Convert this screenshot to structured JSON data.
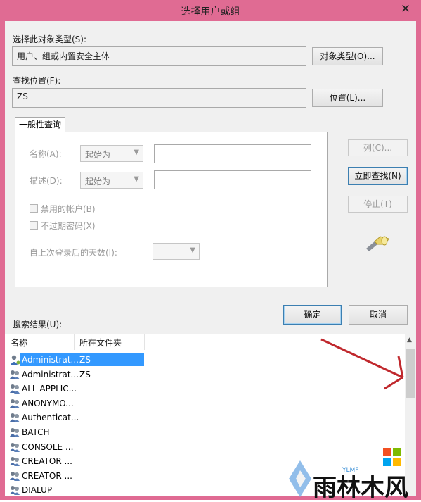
{
  "window": {
    "title": "选择用户或组",
    "close_glyph": "✕"
  },
  "object_type": {
    "label": "选择此对象类型(S):",
    "value": "用户、组或内置安全主体",
    "button": "对象类型(O)..."
  },
  "location": {
    "label": "查找位置(F):",
    "value": "ZS",
    "button": "位置(L)..."
  },
  "query": {
    "tab_label": "一般性查询",
    "name_label": "名称(A):",
    "name_mode": "起始为",
    "desc_label": "描述(D):",
    "desc_mode": "起始为",
    "disabled_accounts": "禁用的帐户(B)",
    "non_expiring_pw": "不过期密码(X)",
    "days_since_login": "自上次登录后的天数(I):"
  },
  "actions": {
    "columns": "列(C)...",
    "find_now": "立即查找(N)",
    "stop": "停止(T)",
    "ok": "确定",
    "cancel": "取消"
  },
  "results": {
    "label": "搜索结果(U):",
    "headers": [
      "名称",
      "所在文件夹"
    ],
    "rows": [
      {
        "name": "Administrat...",
        "folder": "ZS",
        "icon": "user-icon",
        "selected": true
      },
      {
        "name": "Administrat...",
        "folder": "ZS",
        "icon": "group-icon",
        "selected": false
      },
      {
        "name": "ALL APPLIC...",
        "folder": "",
        "icon": "group-icon",
        "selected": false
      },
      {
        "name": "ANONYMO...",
        "folder": "",
        "icon": "group-icon",
        "selected": false
      },
      {
        "name": "Authenticat...",
        "folder": "",
        "icon": "group-icon",
        "selected": false
      },
      {
        "name": "BATCH",
        "folder": "",
        "icon": "group-icon",
        "selected": false
      },
      {
        "name": "CONSOLE ...",
        "folder": "",
        "icon": "group-icon",
        "selected": false
      },
      {
        "name": "CREATOR ...",
        "folder": "",
        "icon": "group-icon",
        "selected": false
      },
      {
        "name": "CREATOR ...",
        "folder": "",
        "icon": "group-icon",
        "selected": false
      },
      {
        "name": "DIALUP",
        "folder": "",
        "icon": "group-icon",
        "selected": false
      }
    ]
  },
  "watermark": {
    "text": "雨林木风",
    "sub": "YLMF"
  },
  "colors": {
    "frame": "#e06b93",
    "selection": "#3399ff",
    "annotation_arrow": "#c0282d"
  }
}
